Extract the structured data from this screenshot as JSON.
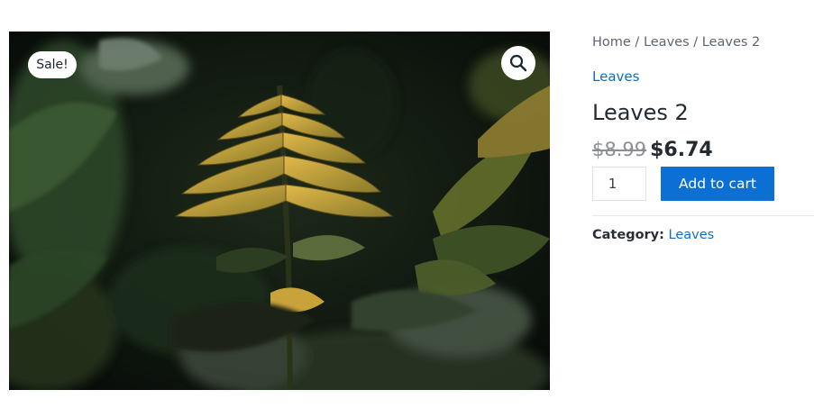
{
  "product": {
    "image_alt": "Leaves 2",
    "sale_badge": "Sale!",
    "zoom_icon": "magnifier-icon",
    "breadcrumb": {
      "home": "Home",
      "sep1": " / ",
      "category": "Leaves",
      "sep2": " / ",
      "current": "Leaves 2"
    },
    "category_link": "Leaves",
    "title": "Leaves 2",
    "price": {
      "regular": "$8.99",
      "sale": "$6.74"
    },
    "quantity": "1",
    "add_to_cart_label": "Add to cart",
    "meta": {
      "category_label": "Category:",
      "category_value": "Leaves"
    }
  },
  "colors": {
    "accent": "#0b6fd3",
    "link": "#0b6fc9",
    "text": "#242a31"
  }
}
